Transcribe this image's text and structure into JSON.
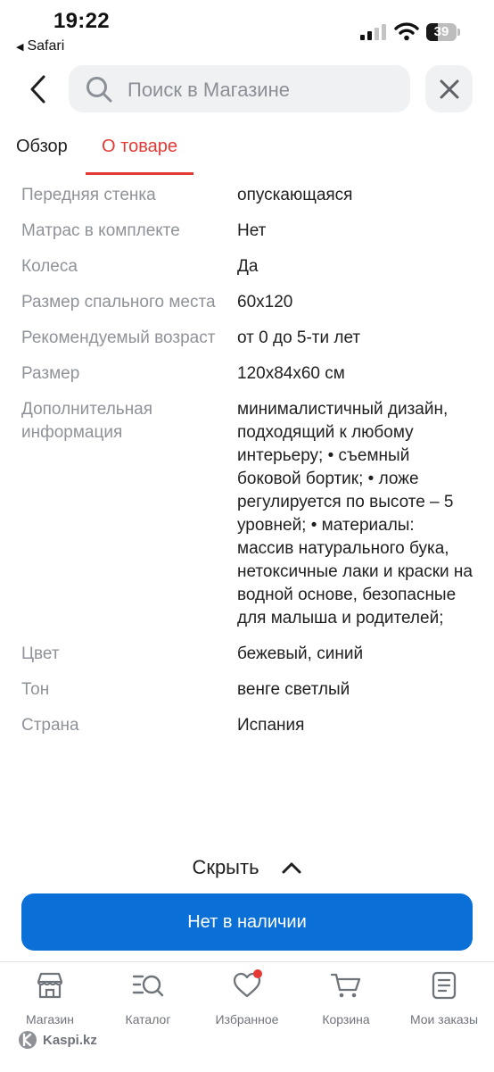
{
  "status_bar": {
    "time": "19:22",
    "back_app": "Safari",
    "battery_percent": 39
  },
  "search": {
    "placeholder": "Поиск в Магазине",
    "icon": "search-icon"
  },
  "tabs": [
    {
      "label": "Обзор",
      "active": false
    },
    {
      "label": "О товаре",
      "active": true
    }
  ],
  "specs": [
    {
      "name": "Передняя стенка",
      "value": "опускающаяся"
    },
    {
      "name": "Матрас в комплекте",
      "value": "Нет"
    },
    {
      "name": "Колеса",
      "value": "Да"
    },
    {
      "name": "Размер спального места",
      "value": "60x120"
    },
    {
      "name": "Рекомендуемый возраст",
      "value": "от 0 до 5-ти лет"
    },
    {
      "name": "Размер",
      "value": "120x84x60 см"
    },
    {
      "name": "Дополнительная информация",
      "value": "минималистичный дизайн, подходящий к любому интерьеру; • съемный боковой бортик; • ложе регулируется по высоте – 5 уровней; • материалы: массив натурального бука, нетоксичные лаки и краски на водной основе, безопасные для малыша и родителей;"
    },
    {
      "name": "Цвет",
      "value": "бежевый, синий"
    },
    {
      "name": "Тон",
      "value": "венге светлый"
    },
    {
      "name": "Страна",
      "value": "Испания"
    }
  ],
  "collapse_label": "Скрыть",
  "availability_label": "Нет в наличии",
  "bottom_nav": [
    {
      "label": "Магазин",
      "icon": "shop-icon"
    },
    {
      "label": "Каталог",
      "icon": "catalog-icon"
    },
    {
      "label": "Избранное",
      "icon": "heart-icon",
      "badge": true
    },
    {
      "label": "Корзина",
      "icon": "cart-icon"
    },
    {
      "label": "Мои заказы",
      "icon": "orders-icon"
    }
  ],
  "brand": "Kaspi.kz",
  "colors": {
    "accent": "#e53935",
    "primary_button": "#0a6fd6",
    "secondary_text": "#8f9399"
  }
}
